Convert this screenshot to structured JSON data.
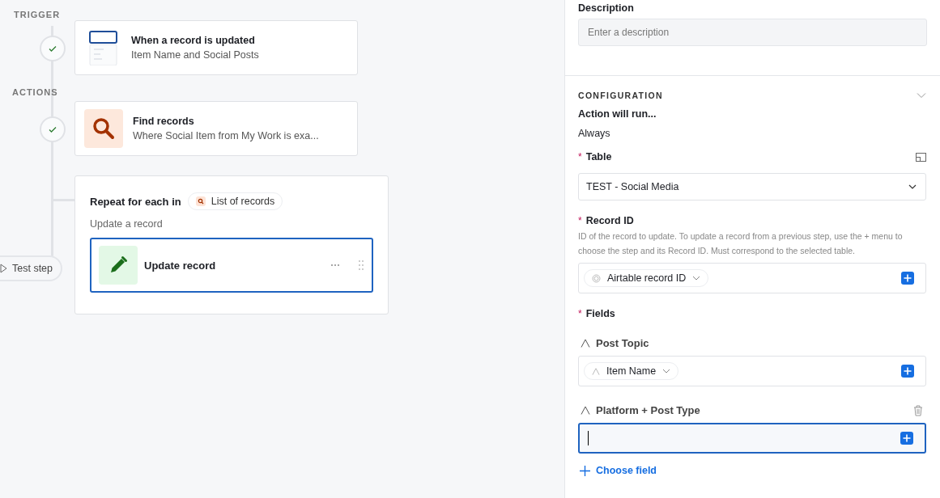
{
  "canvas": {
    "trigger_label": "TRIGGER",
    "actions_label": "ACTIONS",
    "steps": [
      {
        "kind": "trigger",
        "title": "When a record is updated",
        "subtitle": "Item Name and Social Posts",
        "done": true
      },
      {
        "kind": "find",
        "title": "Find records",
        "subtitle": "Where Social Item from My Work is exa...",
        "done": true
      }
    ],
    "repeat": {
      "label": "Repeat for each in",
      "chip": "List of records",
      "subtitle": "Update a record",
      "step": {
        "title": "Update record",
        "selected": true
      }
    },
    "test_step": "Test step"
  },
  "panel": {
    "description": {
      "label": "Description",
      "placeholder": "Enter a description"
    },
    "section": "CONFIGURATION",
    "run_label": "Action will run...",
    "run_value": "Always",
    "table": {
      "mark": "*",
      "label": "Table",
      "value": "TEST - Social Media"
    },
    "record_id": {
      "mark": "*",
      "label": "Record ID",
      "help": "ID of the record to update. To update a record from a previous step, use the + menu to choose the step and its Record ID. Must correspond to the selected table.",
      "chip": "Airtable record ID"
    },
    "fields_mark": "*",
    "fields_label": "Fields",
    "fields": [
      {
        "name": "Post Topic",
        "chip": "Item Name",
        "focused": false,
        "removable": false
      },
      {
        "name": "Platform + Post Type",
        "focused": true,
        "removable": true
      }
    ],
    "choose_field": "Choose field"
  }
}
